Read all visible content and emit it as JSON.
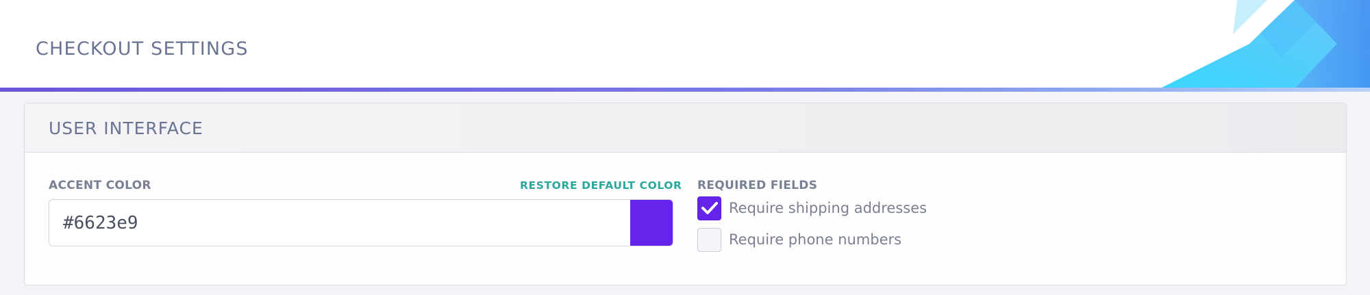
{
  "header": {
    "title": "CHECKOUT SETTINGS"
  },
  "panel": {
    "title": "USER INTERFACE",
    "accent": {
      "label": "ACCENT COLOR",
      "restore_label": "RESTORE DEFAULT COLOR",
      "value": "#6623e9",
      "swatch_color": "#6623e9"
    },
    "required": {
      "label": "REQUIRED FIELDS",
      "options": [
        {
          "label": "Require shipping addresses",
          "checked": true
        },
        {
          "label": "Require phone numbers",
          "checked": false
        }
      ]
    }
  },
  "colors": {
    "accent": "#6623e9",
    "link": "#2ba79b",
    "rule_start": "#6a55dd",
    "rule_end": "#b7d2f7"
  }
}
